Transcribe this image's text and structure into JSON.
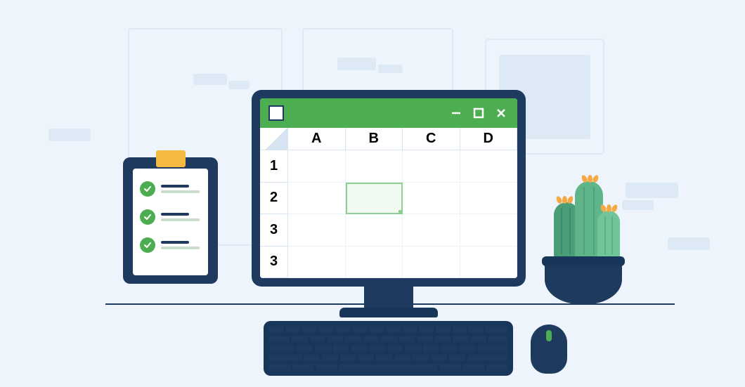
{
  "spreadsheet": {
    "columns": [
      "A",
      "B",
      "C",
      "D"
    ],
    "rows": [
      "1",
      "2",
      "3",
      "3"
    ],
    "selected_cell": "B2"
  },
  "clipboard": {
    "items": [
      {
        "checked": true
      },
      {
        "checked": true
      },
      {
        "checked": true
      }
    ]
  }
}
